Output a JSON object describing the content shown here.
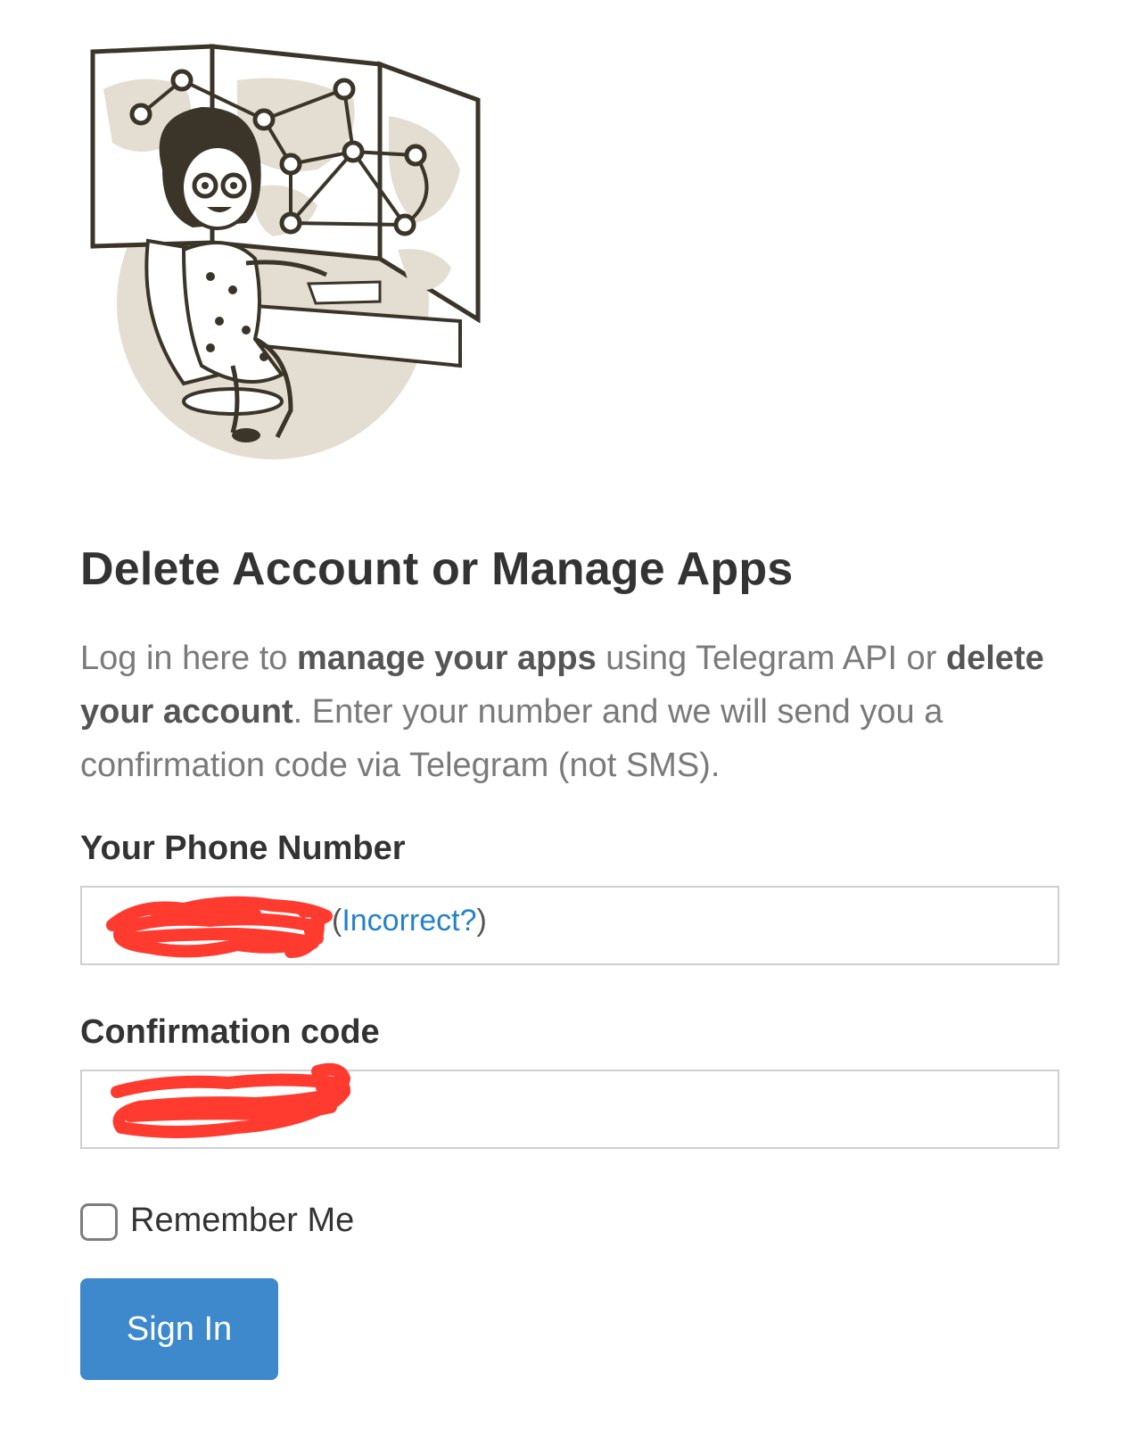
{
  "page": {
    "title": "Delete Account or Manage Apps",
    "intro": {
      "part1": "Log in here to ",
      "bold1": "manage your apps",
      "part2": " using Telegram API or ",
      "bold2": "delete your account",
      "part3": ". Enter your number and we will send you a confirmation code via Telegram (not SMS)."
    }
  },
  "form": {
    "phone": {
      "label": "Your Phone Number",
      "paren_open": "(",
      "incorrect_link": "Incorrect?",
      "paren_close": ")"
    },
    "code": {
      "label": "Confirmation code"
    },
    "remember_label": "Remember Me",
    "remember_checked": false,
    "submit_label": "Sign In"
  },
  "colors": {
    "link": "#2481cc",
    "button": "#3d89cc",
    "redaction": "#ff3b30"
  },
  "icons": [
    "telegram-admin-illustration"
  ]
}
